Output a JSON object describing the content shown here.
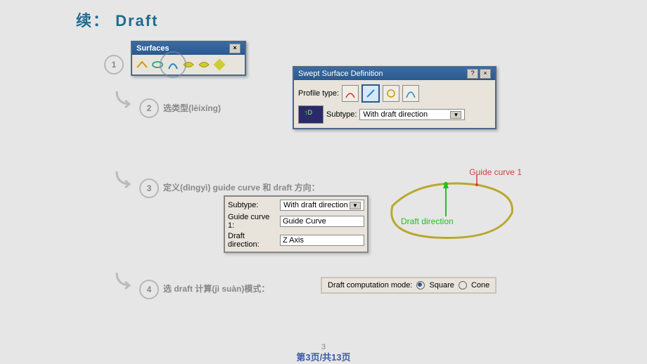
{
  "title": "续： Draft",
  "steps": {
    "s1": "1",
    "s2_num": "2",
    "s2_label": "选类型(lèixíng)",
    "s3_num": "3",
    "s3_label": "定义(dìngyì) guide curve 和 draft 方向：",
    "s4_num": "4",
    "s4_label": "选 draft 计算(jì suàn)模式："
  },
  "surfaces": {
    "title": "Surfaces"
  },
  "swept": {
    "title": "Swept Surface Definition",
    "profile_label": "Profile type:",
    "subtype_label": "Subtype:",
    "subtype_value": "With draft direction"
  },
  "fields": {
    "subtype_label": "Subtype:",
    "subtype_value": "With draft direction",
    "guide_label": "Guide curve 1:",
    "guide_value": "Guide Curve",
    "draft_label": "Draft direction:",
    "draft_value": "Z Axis"
  },
  "sketch": {
    "guide": "Guide curve 1",
    "draft": "Draft direction"
  },
  "mode": {
    "label": "Draft computation mode:",
    "opt1": "Square",
    "opt2": "Cone"
  },
  "footer": {
    "num": "3",
    "text": "第3页/共13页"
  }
}
